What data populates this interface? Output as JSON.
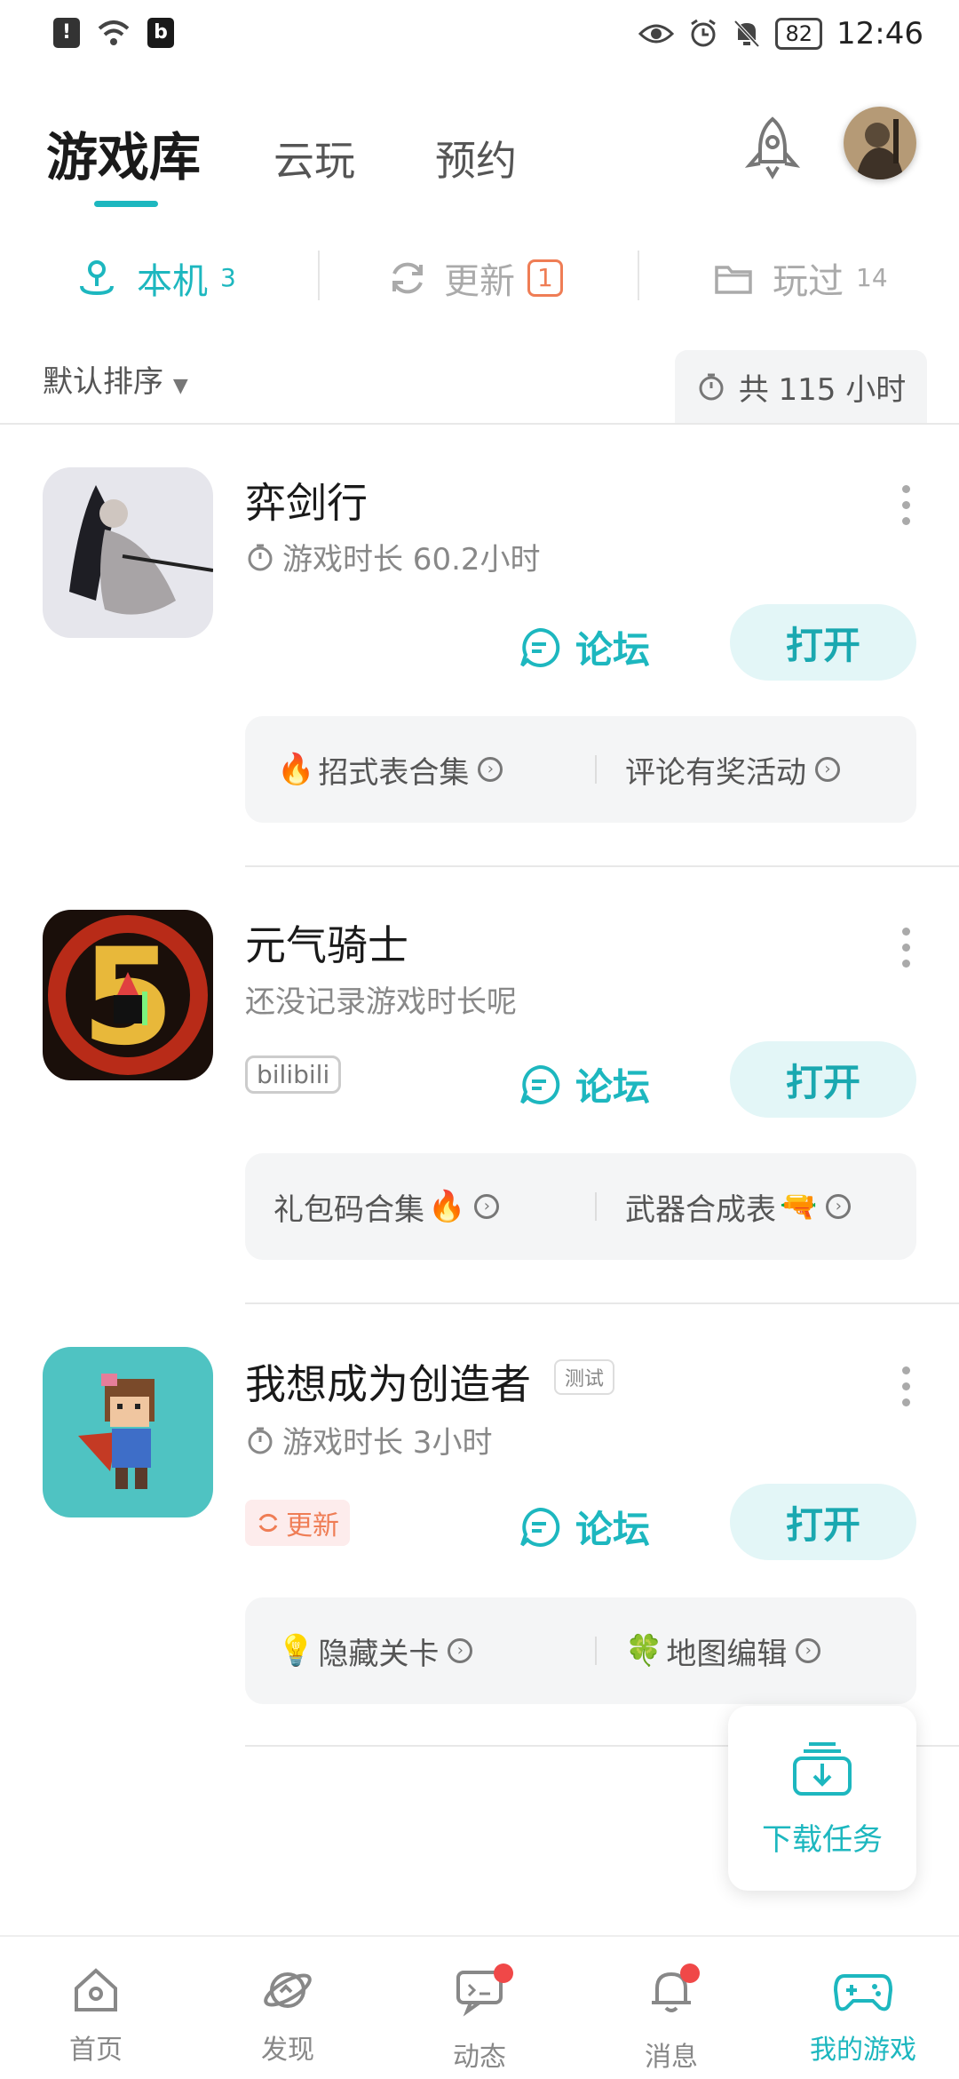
{
  "status_bar": {
    "time": "12:46",
    "battery": "82",
    "icons": [
      "alert-icon",
      "wifi-icon",
      "bilibili-app-icon",
      "eye-icon",
      "alarm-icon",
      "mute-icon",
      "battery-icon"
    ]
  },
  "top_tabs": [
    {
      "label": "游戏库",
      "active": true
    },
    {
      "label": "云玩",
      "active": false
    },
    {
      "label": "预约",
      "active": false
    }
  ],
  "sub_tabs": {
    "local": {
      "label": "本机",
      "count": "3"
    },
    "update": {
      "label": "更新",
      "count": "1"
    },
    "played": {
      "label": "玩过",
      "count": "14"
    }
  },
  "sort_label": "默认排序",
  "total_time": "共 115 小时",
  "games": [
    {
      "name": "弈剑行",
      "playtime": "游戏时长 60.2小时",
      "forum": "论坛",
      "open": "打开",
      "links": [
        "招式表合集",
        "评论有奖活动"
      ]
    },
    {
      "name": "元气骑士",
      "playtime": "还没记录游戏时长呢",
      "tag": "bilibili",
      "forum": "论坛",
      "open": "打开",
      "links": [
        "礼包码合集",
        "武器合成表"
      ]
    },
    {
      "name": "我想成为创造者",
      "tag": "测试",
      "playtime": "游戏时长 3小时",
      "update_tag": "更新",
      "forum": "论坛",
      "open": "打开",
      "links": [
        "隐藏关卡",
        "地图编辑"
      ]
    }
  ],
  "download_task": "下载任务",
  "bottom_nav": [
    {
      "label": "首页",
      "icon": "home-icon"
    },
    {
      "label": "发现",
      "icon": "planet-icon"
    },
    {
      "label": "动态",
      "icon": "message-board-icon",
      "dot": true
    },
    {
      "label": "消息",
      "icon": "bell-icon",
      "dot": true
    },
    {
      "label": "我的游戏",
      "icon": "gamepad-icon",
      "active": true
    }
  ],
  "colors": {
    "accent": "#1db7bf",
    "update": "#ef7d55",
    "dot": "#f04848"
  }
}
